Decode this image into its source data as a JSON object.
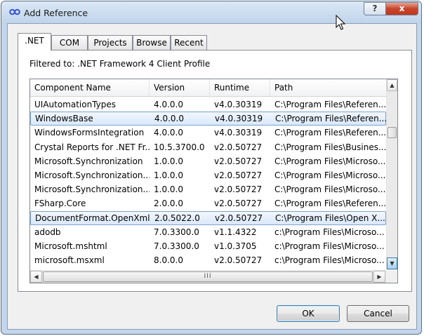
{
  "window": {
    "title": "Add Reference"
  },
  "title_buttons": {
    "help": "?",
    "close": "x"
  },
  "tabs": [
    {
      "label": ".NET",
      "active": true
    },
    {
      "label": "COM",
      "active": false
    },
    {
      "label": "Projects",
      "active": false
    },
    {
      "label": "Browse",
      "active": false
    },
    {
      "label": "Recent",
      "active": false
    }
  ],
  "filter_label": "Filtered to: .NET Framework 4 Client Profile",
  "columns": [
    "Component Name",
    "Version",
    "Runtime",
    "Path"
  ],
  "rows": [
    {
      "name": "UIAutomationTypes",
      "version": "4.0.0.0",
      "runtime": "v4.0.30319",
      "path": "C:\\Program Files\\Referen...",
      "selected": false
    },
    {
      "name": "WindowsBase",
      "version": "4.0.0.0",
      "runtime": "v4.0.30319",
      "path": "C:\\Program Files\\Referen...",
      "selected": true
    },
    {
      "name": "WindowsFormsIntegration",
      "version": "4.0.0.0",
      "runtime": "v4.0.30319",
      "path": "C:\\Program Files\\Referen...",
      "selected": false
    },
    {
      "name": "Crystal Reports for .NET Fr...",
      "version": "10.5.3700.0",
      "runtime": "v2.0.50727",
      "path": "C:\\Program Files\\Busines...",
      "selected": false
    },
    {
      "name": "Microsoft.Synchronization",
      "version": "1.0.0.0",
      "runtime": "v2.0.50727",
      "path": "C:\\Program Files\\Microso...",
      "selected": false
    },
    {
      "name": "Microsoft.Synchronization...",
      "version": "1.0.0.0",
      "runtime": "v2.0.50727",
      "path": "C:\\Program Files\\Microso...",
      "selected": false
    },
    {
      "name": "Microsoft.Synchronization...",
      "version": "1.0.0.0",
      "runtime": "v2.0.50727",
      "path": "C:\\Program Files\\Microso...",
      "selected": false
    },
    {
      "name": "FSharp.Core",
      "version": "2.0.0.0",
      "runtime": "v2.0.50727",
      "path": "C:\\Program Files\\Referen...",
      "selected": false
    },
    {
      "name": "DocumentFormat.OpenXml",
      "version": "2.0.5022.0",
      "runtime": "v2.0.50727",
      "path": "C:\\Program Files\\Open X...",
      "selected": true
    },
    {
      "name": "adodb",
      "version": "7.0.3300.0",
      "runtime": "v1.1.4322",
      "path": "c:\\Program Files\\Microso...",
      "selected": false
    },
    {
      "name": "Microsoft.mshtml",
      "version": "7.0.3300.0",
      "runtime": "v1.0.3705",
      "path": "c:\\Program Files\\Microso...",
      "selected": false
    },
    {
      "name": "microsoft.msxml",
      "version": "8.0.0.0",
      "runtime": "v2.0.50727",
      "path": "c:\\Program Files\\Microso...",
      "selected": false
    }
  ],
  "scrollbar": {
    "up": "▲",
    "down": "▼",
    "left": "◀",
    "right": "▶",
    "grip": "III"
  },
  "buttons": {
    "ok": "OK",
    "cancel": "Cancel"
  },
  "colors": {
    "selection": "#d9e8fb",
    "selection_border": "#7da2ce",
    "close_button": "#c6452b"
  },
  "icons": [
    "reference-icon",
    "help-icon",
    "close-icon",
    "mouse-cursor-icon"
  ]
}
